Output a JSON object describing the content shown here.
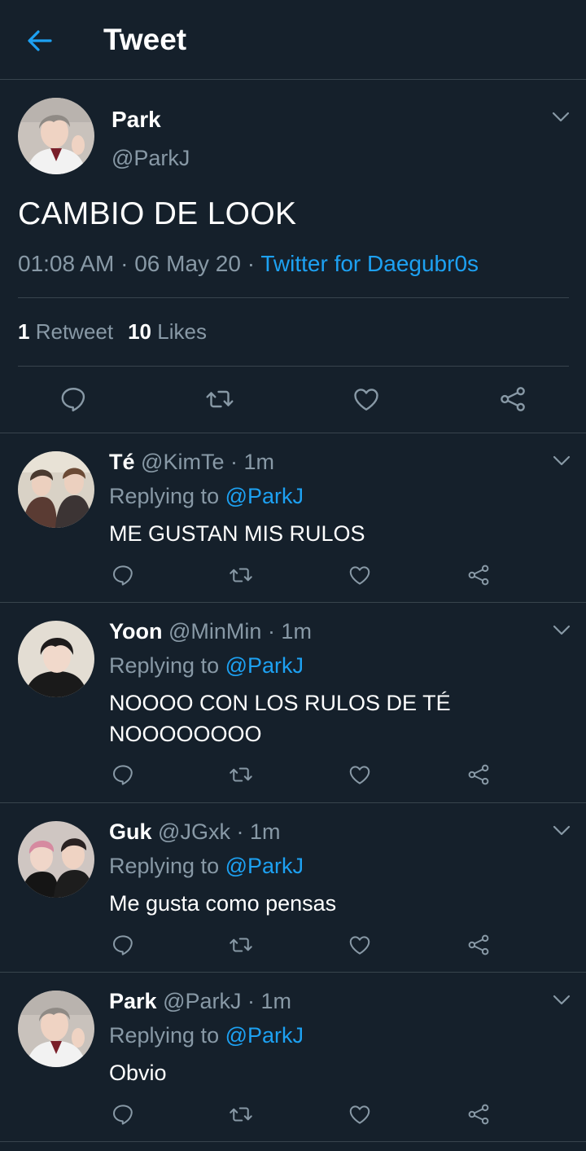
{
  "header": {
    "title": "Tweet"
  },
  "main_tweet": {
    "name": "Park",
    "handle": "@ParkJ",
    "text": "CAMBIO DE LOOK",
    "time": "01:08 AM",
    "date": "06 May 20",
    "separator": "·",
    "source": "Twitter for Daegubr0s",
    "retweet_count": "1",
    "retweet_label": "Retweet",
    "like_count": "10",
    "like_label": "Likes"
  },
  "replies": [
    {
      "name": "Té",
      "handle": "@KimTe",
      "time": "· 1m",
      "replying_label": "Replying to",
      "mention": "@ParkJ",
      "text": "ME GUSTAN MIS RULOS"
    },
    {
      "name": "Yoon",
      "handle": "@MinMin",
      "time": "· 1m",
      "replying_label": "Replying to",
      "mention": "@ParkJ",
      "text": "NOOOO CON LOS RULOS DE TÉ NOOOOOOOO"
    },
    {
      "name": "Guk",
      "handle": "@JGxk",
      "time": "· 1m",
      "replying_label": "Replying to",
      "mention": "@ParkJ",
      "text": "Me gusta como pensas"
    },
    {
      "name": "Park",
      "handle": "@ParkJ",
      "time": "· 1m",
      "replying_label": "Replying to",
      "mention": "@ParkJ",
      "text": "Obvio"
    }
  ],
  "icons": {
    "back": "arrow-left-icon",
    "menu": "chevron-down-icon",
    "reply": "comment-icon",
    "retweet": "retweet-icon",
    "like": "heart-icon",
    "share": "share-icon"
  },
  "colors": {
    "background": "#15202b",
    "accent": "#1da1f2",
    "secondary_text": "#8899a6",
    "divider": "#38444d"
  }
}
